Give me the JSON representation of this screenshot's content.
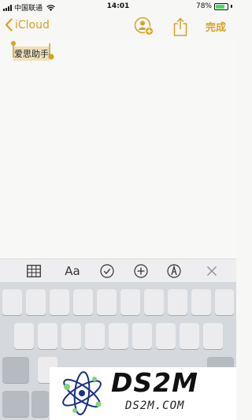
{
  "status_bar": {
    "carrier": "中国联通",
    "time": "14:01",
    "battery_percent": "78%",
    "battery_level": 0.78
  },
  "nav": {
    "back_label": "iCloud",
    "done_label": "完成",
    "accent_color": "#d5a324"
  },
  "note": {
    "text": "爱思助手",
    "selection_color": "#d5a324"
  },
  "toolbar": {
    "text_format_label": "Aa",
    "icons": [
      "table-icon",
      "text-format-icon",
      "checklist-icon",
      "add-icon",
      "markup-icon",
      "close-icon"
    ]
  },
  "watermark": {
    "title": "DS2M",
    "url": "DS2M.COM"
  }
}
